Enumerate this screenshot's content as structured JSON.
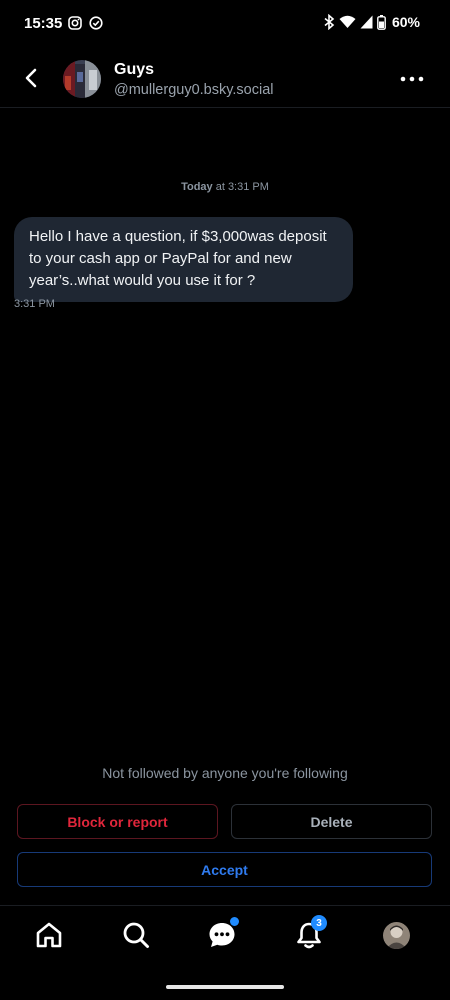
{
  "status_bar": {
    "time": "15:35",
    "battery": "60%",
    "left_icons": [
      "instagram-icon",
      "check-circle-icon"
    ],
    "right_icons": [
      "bluetooth-icon",
      "wifi-icon",
      "signal-icon",
      "battery-icon"
    ]
  },
  "header": {
    "name": "Guys",
    "handle": "@mullerguy0.bsky.social",
    "back_icon": "chevron-left-icon",
    "more_icon": "more-horizontal-icon"
  },
  "conversation": {
    "date_bold": "Today",
    "date_rest": " at 3:31 PM",
    "messages": [
      {
        "text": "Hello I have a question, if $3,000was deposit to your cash app or PayPal for and new year’s..what would you use it for ?",
        "time": "3:31 PM"
      }
    ]
  },
  "request": {
    "notice": "Not followed by anyone you're following",
    "block_label": "Block or report",
    "delete_label": "Delete",
    "accept_label": "Accept"
  },
  "bottom_nav": {
    "items": [
      "home-icon",
      "search-icon",
      "messages-icon",
      "notifications-icon",
      "profile-avatar"
    ],
    "notifications_count": "3"
  },
  "colors": {
    "background": "#000000",
    "bubble": "#1f2733",
    "danger": "#e0263b",
    "accent": "#2f7bef",
    "badge": "#208bfe",
    "muted": "#8b95a0"
  }
}
